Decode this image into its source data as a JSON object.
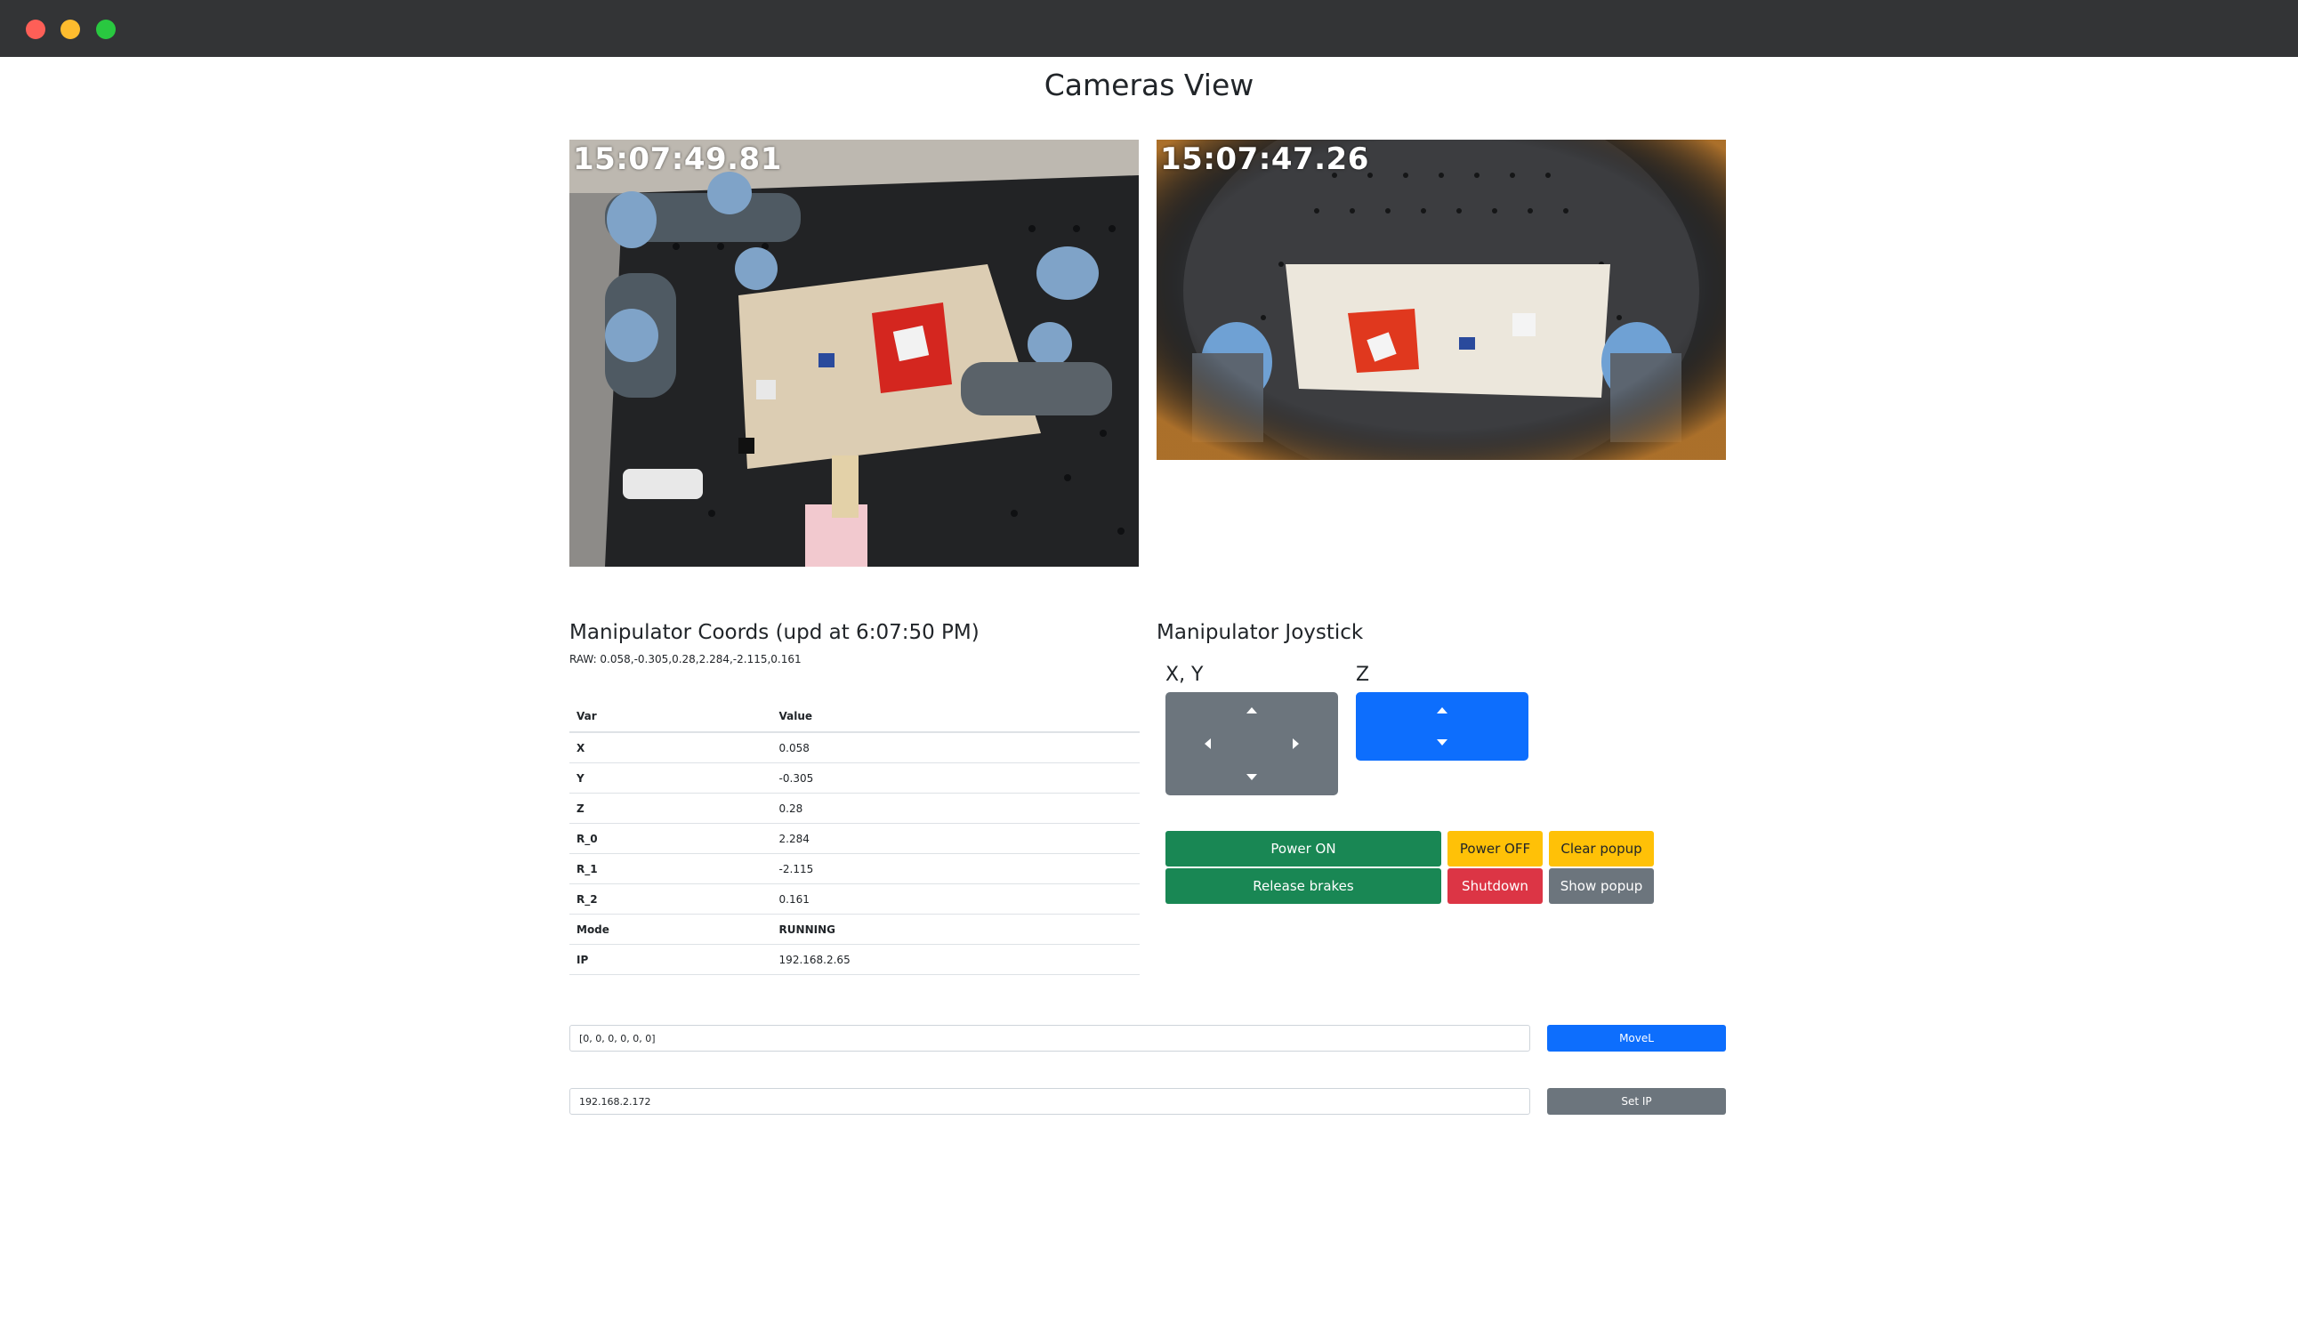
{
  "window": {
    "title": "Cameras View"
  },
  "cameras": [
    {
      "timestamp": "15:07:49.81"
    },
    {
      "timestamp": "15:07:47.26"
    }
  ],
  "coords": {
    "heading": "Manipulator Coords (upd at 6:07:50 PM)",
    "raw": "RAW: 0.058,-0.305,0.28,2.284,-2.115,0.161",
    "columns": [
      "Var",
      "Value"
    ],
    "rows": [
      {
        "var": "X",
        "value": "0.058"
      },
      {
        "var": "Y",
        "value": "-0.305"
      },
      {
        "var": "Z",
        "value": "0.28"
      },
      {
        "var": "R_0",
        "value": "2.284"
      },
      {
        "var": "R_1",
        "value": "-2.115"
      },
      {
        "var": "R_2",
        "value": "0.161"
      },
      {
        "var": "Mode",
        "value": "RUNNING"
      },
      {
        "var": "IP",
        "value": "192.168.2.65"
      }
    ]
  },
  "joystick": {
    "heading": "Manipulator Joystick",
    "xy_label": "X, Y",
    "z_label": "Z"
  },
  "controls": {
    "power_on": "Power ON",
    "power_off": "Power OFF",
    "clear_popup": "Clear popup",
    "release_brakes": "Release brakes",
    "shutdown": "Shutdown",
    "show_popup": "Show popup"
  },
  "movel": {
    "value": "[0, 0, 0, 0, 0, 0]",
    "button": "MoveL"
  },
  "setip": {
    "value": "192.168.2.172",
    "button": "Set IP"
  },
  "colors": {
    "primary": "#0d6efd",
    "success": "#198754",
    "warning": "#ffc107",
    "danger": "#dc3545",
    "secondary": "#6c757d"
  }
}
